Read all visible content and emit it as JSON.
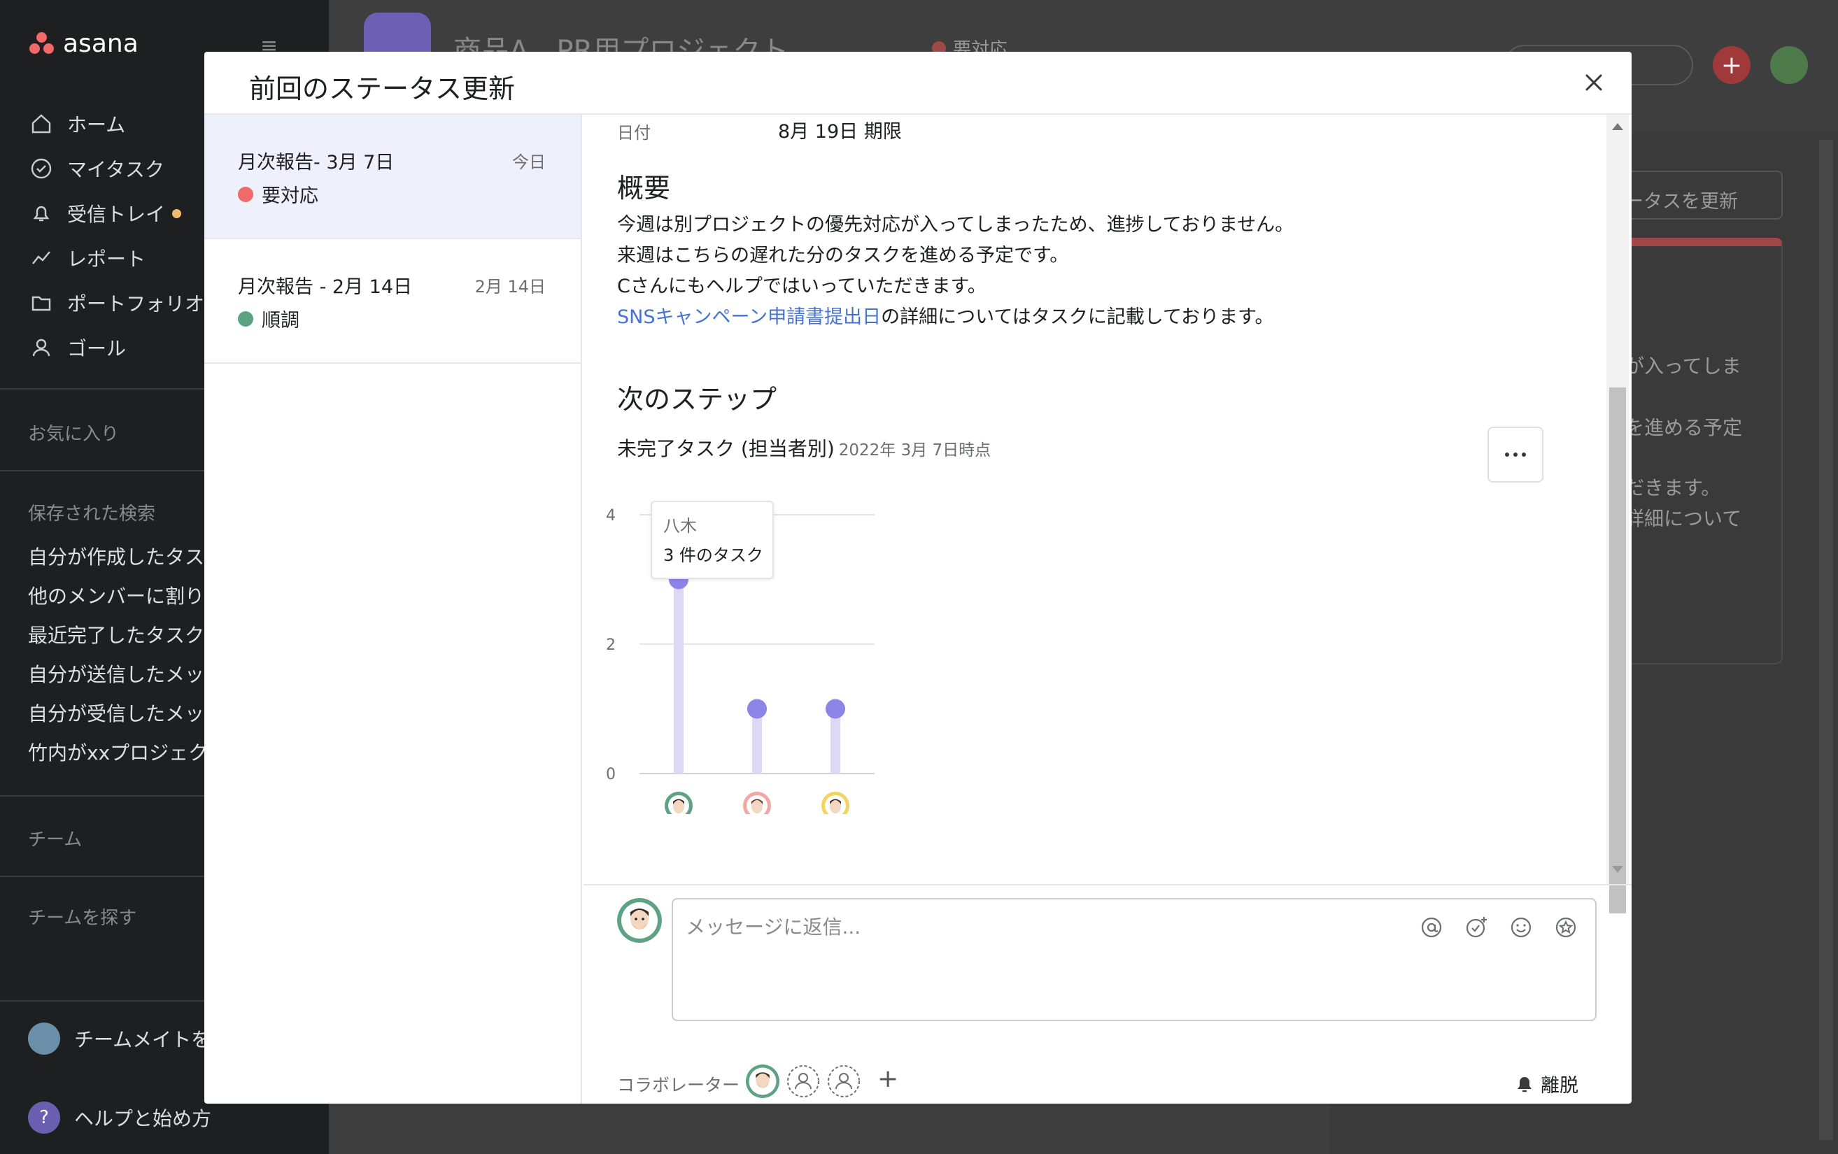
{
  "sidebar": {
    "logo": "asana",
    "nav": [
      {
        "label": "ホーム",
        "icon": "home-icon"
      },
      {
        "label": "マイタスク",
        "icon": "check-circle-icon"
      },
      {
        "label": "受信トレイ",
        "icon": "bell-icon"
      },
      {
        "label": "レポート",
        "icon": "chart-line-icon"
      },
      {
        "label": "ポートフォリオ",
        "icon": "folder-icon"
      },
      {
        "label": "ゴール",
        "icon": "person-icon"
      }
    ],
    "favorites_heading": "お気に入り",
    "saved_heading": "保存された検索",
    "saved": [
      "自分が作成したタスク",
      "他のメンバーに割り",
      "最近完了したタスク",
      "自分が送信したメッ",
      "自分が受信したメッ",
      "竹内がxxプロジェク"
    ],
    "team_heading": "チーム",
    "find_team": "チームを探す",
    "invite": "チームメイトを",
    "help": "ヘルプと始め方"
  },
  "background": {
    "project_title": "商品A　PR用プロジェクト",
    "project_status": "要対応",
    "update_button": "ータスを更新",
    "card_lines": [
      "が入ってしま",
      "を進める予定",
      "だきます。",
      "詳細について"
    ]
  },
  "modal": {
    "title": "前回のステータス更新",
    "updates": [
      {
        "title": "月次報告- 3月 7日",
        "date": "今日",
        "status": "要対応",
        "color": "#f06a6a"
      },
      {
        "title": "月次報告 - 2月 14日",
        "date": "2月 14日",
        "status": "順調",
        "color": "#5da283"
      }
    ],
    "date_label": "日付",
    "date_value": "8月 19日 期限",
    "summary_title": "概要",
    "summary_lines": [
      "今週は別プロジェクトの優先対応が入ってしまったため、進捗しておりません。",
      "来週はこちらの遅れた分のタスクを進める予定です。",
      "Cさんにもヘルプではいっていただきます。"
    ],
    "summary_link": "SNSキャンペーン申請書提出日",
    "summary_link_suffix": "の詳細についてはタスクに記載しております。",
    "next_title": "次のステップ",
    "chart_title": "未完了タスク (担当者別)",
    "chart_meta": "2022年 3月 7日時点",
    "tooltip_name": "八木",
    "tooltip_count": "3 件のタスク",
    "reply_placeholder": "メッセージに返信...",
    "collaborators_label": "コラボレーター",
    "leave": "離脱"
  },
  "chart_data": {
    "type": "bar",
    "title": "未完了タスク (担当者別)",
    "categories": [
      "八木",
      "",
      ""
    ],
    "values": [
      3,
      1,
      1
    ],
    "ylim": [
      0,
      4
    ],
    "yticks": [
      "0",
      "2",
      "4"
    ],
    "colors": {
      "bar": "#dcd8f5",
      "point": "#8d84e8",
      "grid": "#e4e4e4"
    }
  },
  "colors": {
    "accent": "#4573d2",
    "danger": "#f06a6a",
    "ok": "#5da283"
  }
}
